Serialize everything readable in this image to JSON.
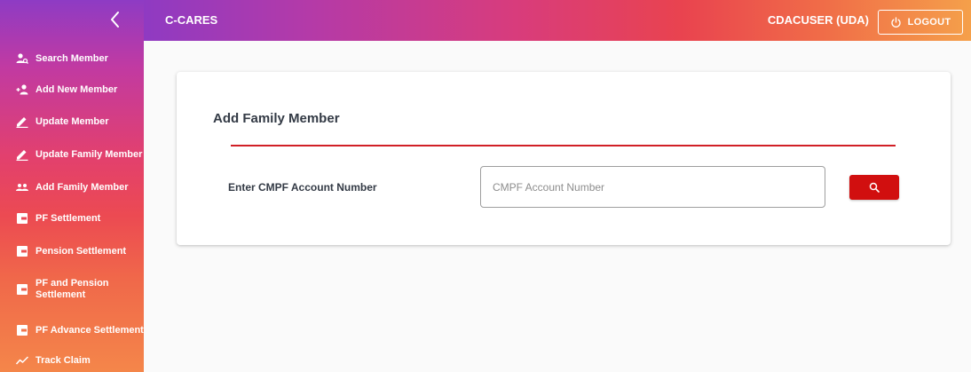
{
  "header": {
    "app_title": "C-CARES",
    "user_name": "CDACUSER (UDA)",
    "logout_label": "LOGOUT"
  },
  "sidebar": {
    "items": [
      {
        "label": "Search Member",
        "icon": "search-member-icon"
      },
      {
        "label": "Add New Member",
        "icon": "add-person-icon"
      },
      {
        "label": "Update Member",
        "icon": "edit-icon"
      },
      {
        "label": "Update Family Member",
        "icon": "edit-icon"
      },
      {
        "label": "Add Family Member",
        "icon": "group-icon"
      },
      {
        "label": "PF Settlement",
        "icon": "wallet-icon"
      },
      {
        "label": "Pension Settlement",
        "icon": "wallet-icon"
      },
      {
        "label": "PF and Pension Settlement",
        "icon": "wallet-icon"
      },
      {
        "label": "PF Advance Settlement",
        "icon": "wallet-icon"
      },
      {
        "label": "Track Claim",
        "icon": "trend-icon"
      }
    ]
  },
  "main": {
    "card_title": "Add Family Member",
    "field_label": "Enter CMPF Account Number",
    "input_placeholder": "CMPF Account Number",
    "input_value": ""
  },
  "colors": {
    "accent_red": "#d10f0f",
    "divider_red": "#d11f26",
    "gradient_purple": "#8e3bc4",
    "gradient_orange": "#f5a04a"
  }
}
